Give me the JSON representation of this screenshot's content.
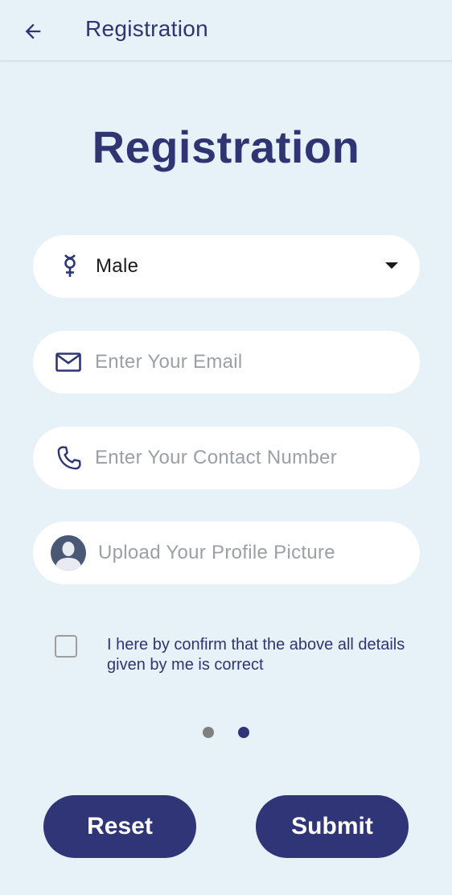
{
  "appbar": {
    "title": "Registration"
  },
  "page": {
    "title": "Registration"
  },
  "form": {
    "gender": {
      "selected": "Male"
    },
    "email": {
      "placeholder": "Enter Your Email"
    },
    "contact": {
      "placeholder": "Enter Your Contact Number"
    },
    "profile": {
      "placeholder": "Upload Your Profile Picture"
    },
    "confirm": {
      "text": "I here by confirm that the above all details given by me is correct",
      "checked": false
    }
  },
  "pager": {
    "count": 2,
    "active_index": 1
  },
  "buttons": {
    "reset_label": "Reset",
    "submit_label": "Submit"
  },
  "colors": {
    "primary": "#2f3577",
    "background": "#e6f2f7",
    "dot_inactive": "#808080"
  },
  "icons": {
    "back": "arrow-left-icon",
    "gender": "gender-icon",
    "email": "mail-icon",
    "phone": "phone-icon",
    "profile": "avatar-icon",
    "dropdown": "dropdown-arrow-icon"
  }
}
